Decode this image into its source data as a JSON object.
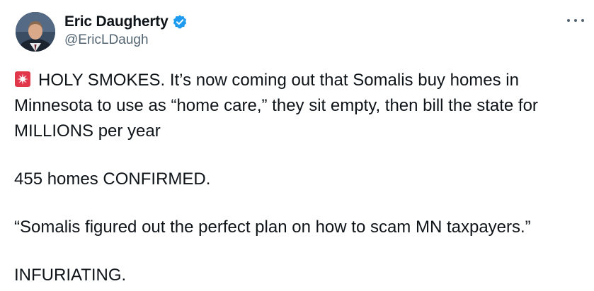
{
  "author": {
    "display_name": "Eric Daugherty",
    "handle": "@EricLDaugh",
    "verified": true,
    "avatar": "avatar-photo",
    "verified_badge_color": "#1d9bf0"
  },
  "menu": {
    "more_icon": "more-horizontal-icon"
  },
  "tweet": {
    "lead_emoji": "rotating-light-emoji",
    "line1": "HOLY SMOKES. It’s now coming out that Somalis buy homes in Minnesota to use as “home care,” they sit empty, then bill the state for MILLIONS per year",
    "line2": "455 homes CONFIRMED.",
    "line3": "“Somalis figured out the perfect plan on how to scam MN taxpayers.”",
    "line4": "INFURIATING."
  },
  "colors": {
    "text_primary": "#0f1419",
    "text_secondary": "#536471",
    "siren_red": "#e0384a"
  }
}
